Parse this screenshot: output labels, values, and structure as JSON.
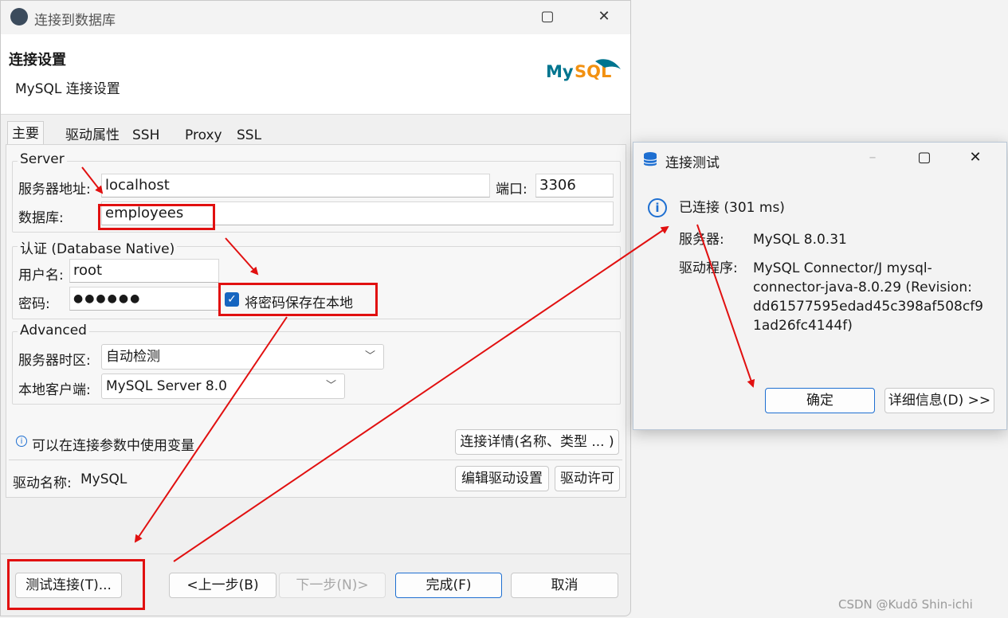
{
  "main": {
    "window_title": "连接到数据库",
    "header_title": "连接设置",
    "header_subtitle": "MySQL 连接设置",
    "logo_text": "MySQL",
    "tabs": [
      "主要",
      "驱动属性",
      "SSH",
      "Proxy",
      "SSL"
    ],
    "server": {
      "group_title": "Server",
      "host_label": "服务器地址:",
      "host_value": "localhost",
      "port_label": "端口:",
      "port_value": "3306",
      "db_label": "数据库:",
      "db_value": "employees"
    },
    "auth": {
      "group_title": "认证 (Database Native)",
      "user_label": "用户名:",
      "user_value": "root",
      "pass_label": "密码:",
      "pass_value": "●●●●●●",
      "save_pass_label": "将密码保存在本地"
    },
    "advanced": {
      "group_title": "Advanced",
      "tz_label": "服务器时区:",
      "tz_value": "自动检测",
      "client_label": "本地客户端:",
      "client_value": "MySQL Server 8.0"
    },
    "info_text": "可以在连接参数中使用变量",
    "conn_details_button": "连接详情(名称、类型 ... )",
    "driver_label": "驱动名称:",
    "driver_value": "MySQL",
    "edit_driver_button": "编辑驱动设置",
    "driver_license_button": "驱动许可",
    "buttons": {
      "test": "测试连接(T)...",
      "back": "<上一步(B)",
      "next": "下一步(N)>",
      "finish": "完成(F)",
      "cancel": "取消"
    }
  },
  "test_dialog": {
    "title": "连接测试",
    "status": "已连接 (301 ms)",
    "server_label": "服务器:",
    "server_value": "MySQL 8.0.31",
    "driver_label": "驱动程序:",
    "driver_lines": [
      "MySQL Connector/J mysql-",
      "connector-java-8.0.29 (Revision:",
      "dd61577595edad45c398af508cf9",
      "1ad26fc4144f)"
    ],
    "ok_button": "确定",
    "details_button": "详细信息(D) >>"
  },
  "watermark": "CSDN @Kudō Shin-ichi",
  "colors": {
    "accent": "#1e6fd1",
    "annotation": "#e11010",
    "checkbox": "#1565c0"
  }
}
